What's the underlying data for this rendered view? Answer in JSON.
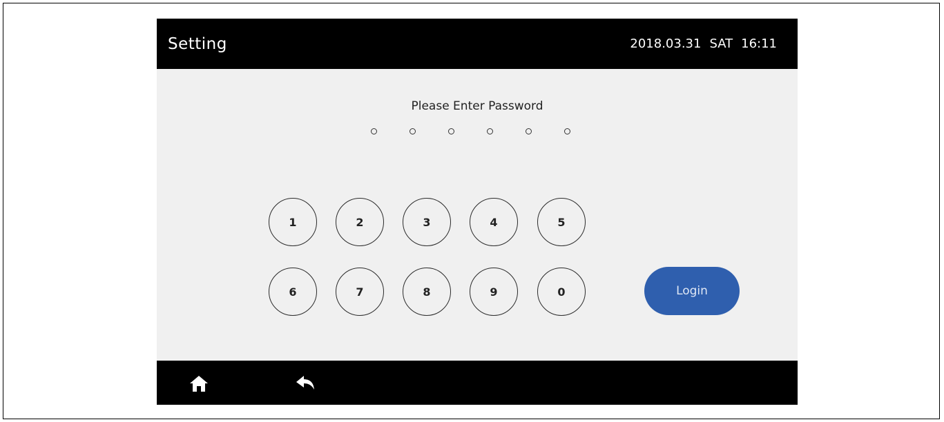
{
  "header": {
    "title": "Setting",
    "date": "2018.03.31",
    "weekday": "SAT",
    "time": "16:11"
  },
  "password": {
    "prompt": "Please Enter Password",
    "length": 6,
    "entered": 0
  },
  "keypad": {
    "row1": [
      "1",
      "2",
      "3",
      "4",
      "5"
    ],
    "row2": [
      "6",
      "7",
      "8",
      "9",
      "0"
    ]
  },
  "login": {
    "label": "Login"
  },
  "footer": {
    "icons": [
      "home-icon",
      "back-icon"
    ]
  },
  "colors": {
    "bar_background": "#000000",
    "screen_background": "#f0f0f0",
    "login_button": "#2f5fae"
  }
}
